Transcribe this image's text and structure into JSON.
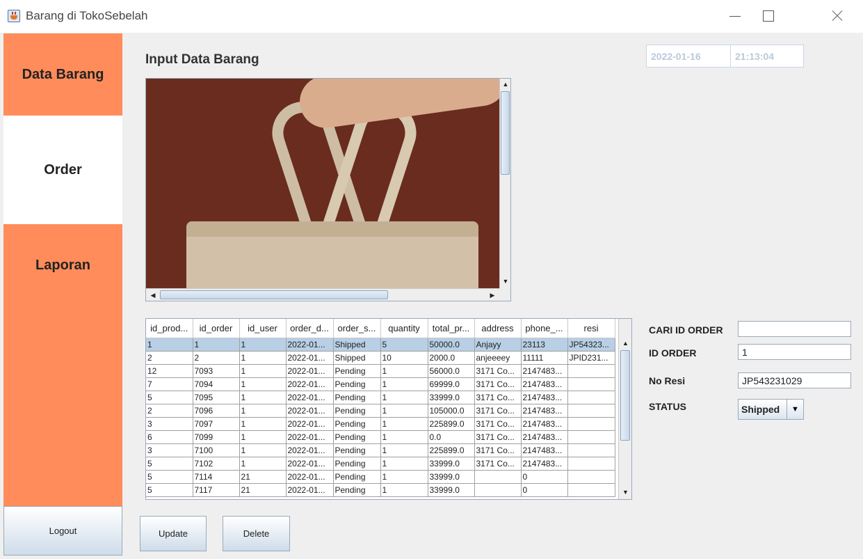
{
  "window": {
    "title": "Barang di TokoSebelah"
  },
  "sidebar": {
    "items": [
      {
        "label": "Data Barang"
      },
      {
        "label": "Order"
      },
      {
        "label": "Laporan"
      }
    ],
    "logout_label": "Logout"
  },
  "main": {
    "heading": "Input Data Barang",
    "date": "2022-01-16",
    "time": "21:13:04"
  },
  "table": {
    "columns": [
      "id_prod...",
      "id_order",
      "id_user",
      "order_d...",
      "order_s...",
      "quantity",
      "total_pr...",
      "address",
      "phone_...",
      "resi"
    ],
    "rows": [
      [
        "1",
        "1",
        "1",
        "2022-01...",
        "Shipped",
        "5",
        "50000.0",
        "Anjayy",
        "23113",
        "JP54323..."
      ],
      [
        "2",
        "2",
        "1",
        "2022-01...",
        "Shipped",
        "10",
        "2000.0",
        "anjeeeey",
        "11111",
        "JPID231..."
      ],
      [
        "12",
        "7093",
        "1",
        "2022-01...",
        "Pending",
        "1",
        "56000.0",
        "3171 Co...",
        "2147483...",
        ""
      ],
      [
        "7",
        "7094",
        "1",
        "2022-01...",
        "Pending",
        "1",
        "69999.0",
        "3171 Co...",
        "2147483...",
        ""
      ],
      [
        "5",
        "7095",
        "1",
        "2022-01...",
        "Pending",
        "1",
        "33999.0",
        "3171 Co...",
        "2147483...",
        ""
      ],
      [
        "2",
        "7096",
        "1",
        "2022-01...",
        "Pending",
        "1",
        "105000.0",
        "3171 Co...",
        "2147483...",
        ""
      ],
      [
        "3",
        "7097",
        "1",
        "2022-01...",
        "Pending",
        "1",
        "225899.0",
        "3171 Co...",
        "2147483...",
        ""
      ],
      [
        "6",
        "7099",
        "1",
        "2022-01...",
        "Pending",
        "1",
        "0.0",
        "3171 Co...",
        "2147483...",
        ""
      ],
      [
        "3",
        "7100",
        "1",
        "2022-01...",
        "Pending",
        "1",
        "225899.0",
        "3171 Co...",
        "2147483...",
        ""
      ],
      [
        "5",
        "7102",
        "1",
        "2022-01...",
        "Pending",
        "1",
        "33999.0",
        "3171 Co...",
        "2147483...",
        ""
      ],
      [
        "5",
        "7114",
        "21",
        "2022-01...",
        "Pending",
        "1",
        "33999.0",
        "",
        "0",
        ""
      ],
      [
        "5",
        "7117",
        "21",
        "2022-01...",
        "Pending",
        "1",
        "33999.0",
        "",
        "0",
        ""
      ]
    ],
    "selected_row": 0
  },
  "form": {
    "cari_label": "CARI ID ORDER",
    "cari_value": "",
    "id_label": "ID ORDER",
    "id_value": "1",
    "resi_label": "No Resi",
    "resi_value": "JP543231029",
    "status_label": "STATUS",
    "status_value": "Shipped"
  },
  "buttons": {
    "update_label": "Update",
    "delete_label": "Delete"
  },
  "colors": {
    "sidebar_accent": "#ff8c5a",
    "selected_row": "#b8cfe5",
    "datetime_text": "#b9c9da"
  }
}
